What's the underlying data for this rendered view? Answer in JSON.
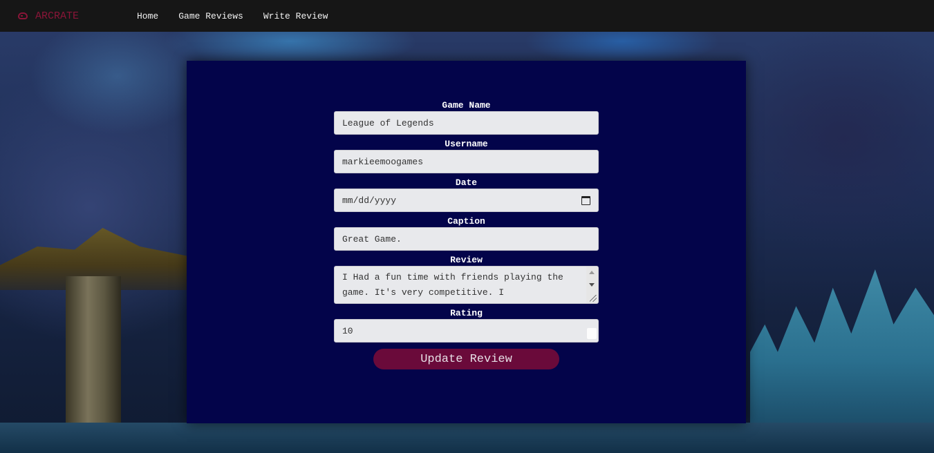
{
  "nav": {
    "brand": "ARCRATE",
    "links": [
      "Home",
      "Game Reviews",
      "Write Review"
    ]
  },
  "form": {
    "game_name_label": "Game Name",
    "game_name_value": "League of Legends",
    "username_label": "Username",
    "username_value": "markieemoogames",
    "date_label": "Date",
    "date_placeholder": "mm/dd/yyyy",
    "caption_label": "Caption",
    "caption_value": "Great Game.",
    "review_label": "Review",
    "review_value": "I Had a fun time with friends playing the game. It's very competitive. I",
    "rating_label": "Rating",
    "rating_value": "10",
    "submit_label": "Update Review"
  },
  "colors": {
    "navbar": "#161616",
    "brand": "#8a1538",
    "panel": "#03044a",
    "button": "#6a0a3a"
  }
}
